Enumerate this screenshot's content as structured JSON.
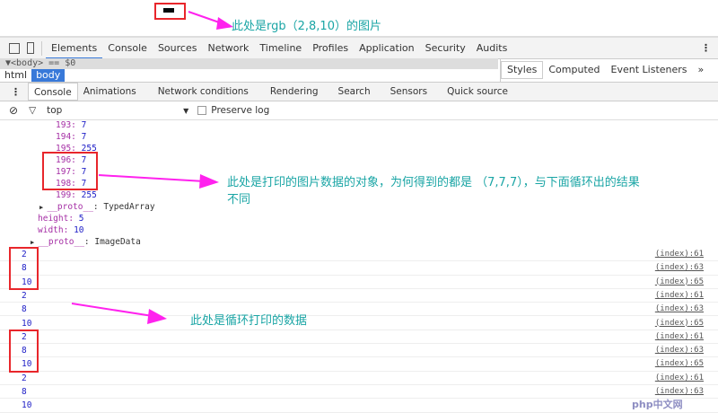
{
  "annotations": {
    "image_note": "此处是rgb（2,8,10）的图片",
    "object_note": "此处是打印的图片数据的对象，为何得到的都是 （7,7,7），与下面循环出的结果",
    "object_note_2": "不同",
    "loop_note": "此处是循环打印的数据"
  },
  "colors": {
    "pixel": "#02080a",
    "accent": "#3879d9",
    "annotation": "#1aa5a5",
    "arrow": "#ff22ee",
    "box": "#e8262b"
  },
  "toolbar": {
    "tabs": [
      "Elements",
      "Console",
      "Sources",
      "Network",
      "Timeline",
      "Profiles",
      "Application",
      "Security",
      "Audits"
    ],
    "active": "Elements"
  },
  "elements": {
    "selected": "▼<body> == $0",
    "crumbs": [
      "html",
      "body"
    ]
  },
  "sidebar": {
    "tabs": [
      "Styles",
      "Computed",
      "Event Listeners",
      "»"
    ]
  },
  "drawer": {
    "tabs": [
      "Console",
      "Animations",
      "Network conditions",
      "Rendering",
      "Search",
      "Sensors",
      "Quick source"
    ]
  },
  "filter": {
    "context": "top",
    "preserve_log": "Preserve log"
  },
  "object": {
    "entries": [
      {
        "k": "193",
        "v": "7"
      },
      {
        "k": "194",
        "v": "7"
      },
      {
        "k": "195",
        "v": "255"
      },
      {
        "k": "196",
        "v": "7"
      },
      {
        "k": "197",
        "v": "7"
      },
      {
        "k": "198",
        "v": "7"
      },
      {
        "k": "199",
        "v": "255"
      }
    ],
    "proto_typed": "__proto__",
    "proto_typed_val": ": TypedArray",
    "height_k": "height",
    "height_v": "5",
    "width_k": "width",
    "width_v": "10",
    "proto_img": "__proto__",
    "proto_img_val": ": ImageData"
  },
  "logs": [
    {
      "v": "2",
      "ref": "(index):61"
    },
    {
      "v": "8",
      "ref": "(index):63"
    },
    {
      "v": "10",
      "ref": "(index):65"
    },
    {
      "v": "2",
      "ref": "(index):61"
    },
    {
      "v": "8",
      "ref": "(index):63"
    },
    {
      "v": "10",
      "ref": "(index):65"
    },
    {
      "v": "2",
      "ref": "(index):61"
    },
    {
      "v": "8",
      "ref": "(index):63"
    },
    {
      "v": "10",
      "ref": "(index):65"
    },
    {
      "v": "2",
      "ref": "(index):61"
    },
    {
      "v": "8",
      "ref": "(index):63"
    },
    {
      "v": "10",
      "ref": ""
    }
  ],
  "watermark": "php中文网"
}
